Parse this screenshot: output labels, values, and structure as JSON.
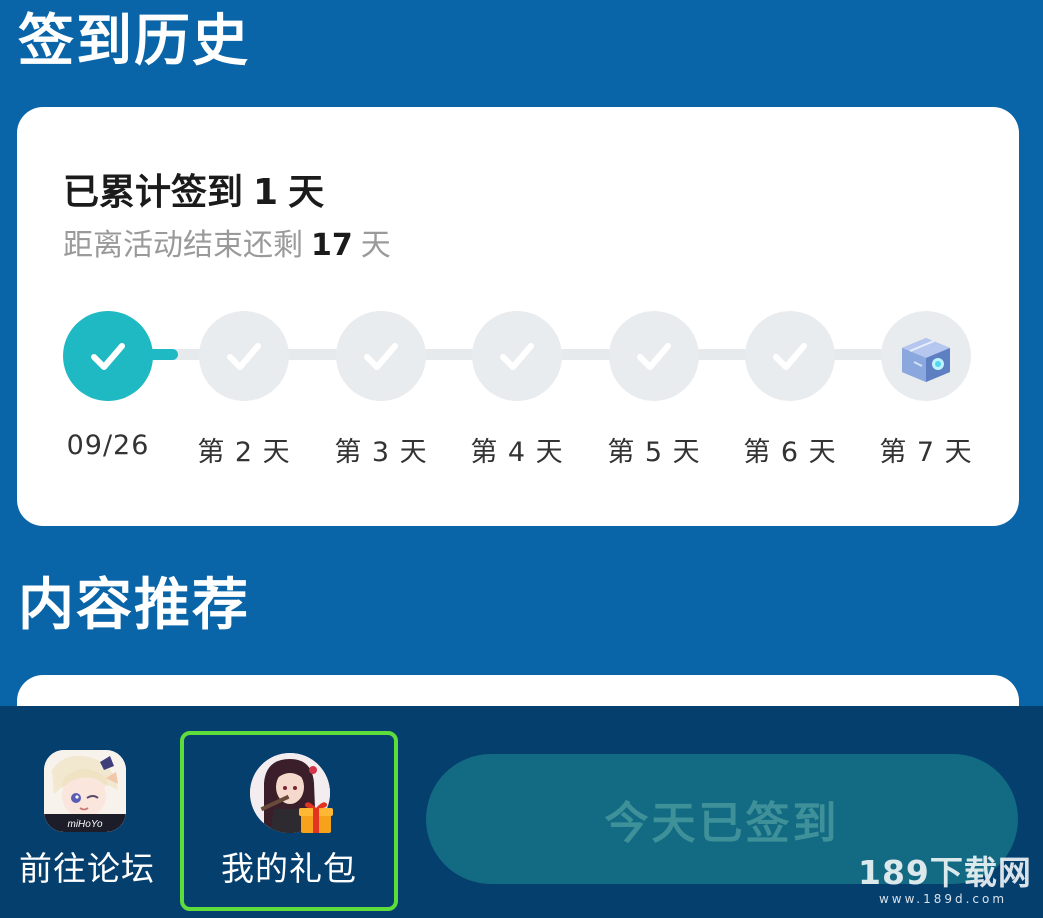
{
  "history": {
    "title": "签到历史",
    "streak_prefix": "已累计签到",
    "streak_days": "1",
    "streak_suffix": "天",
    "remain_prefix": "距离活动结束还剩",
    "remain_days": "17",
    "remain_suffix": "天",
    "progress_completed_days": 1,
    "progress_total_days": 7,
    "days": [
      {
        "label": "09/26",
        "state": "done",
        "icon": "check-icon"
      },
      {
        "label": "第 2 天",
        "state": "pending",
        "icon": "check-icon"
      },
      {
        "label": "第 3 天",
        "state": "pending",
        "icon": "check-icon"
      },
      {
        "label": "第 4 天",
        "state": "pending",
        "icon": "check-icon"
      },
      {
        "label": "第 5 天",
        "state": "pending",
        "icon": "check-icon"
      },
      {
        "label": "第 6 天",
        "state": "pending",
        "icon": "check-icon"
      },
      {
        "label": "第 7 天",
        "state": "reward",
        "icon": "treasure-chest-icon"
      }
    ]
  },
  "recommend": {
    "title": "内容推荐"
  },
  "bottom_bar": {
    "forum_label": "前往论坛",
    "forum_icon": "miyoushe-app-icon",
    "forum_icon_text": "miHoYo",
    "gift_label": "我的礼包",
    "gift_icon": "gift-avatar-icon",
    "signed_label": "今天已签到"
  },
  "watermark": {
    "main": "189下载网",
    "url": "www.189d.com"
  },
  "colors": {
    "background": "#0964a8",
    "accent": "#1fb9c4",
    "bottom_bar": "#053f6e",
    "highlight_border": "#5ddc3b"
  }
}
